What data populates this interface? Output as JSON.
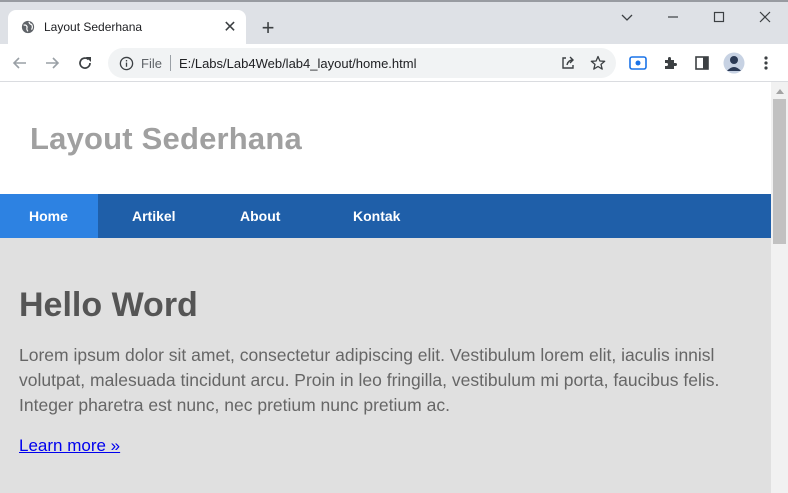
{
  "browser": {
    "tab": {
      "title": "Layout Sederhana",
      "favicon": "globe-icon"
    },
    "new_tab_symbol": "+",
    "close_symbol": "✕",
    "address": {
      "scheme": "File",
      "url": "E:/Labs/Lab4Web/lab4_layout/home.html"
    },
    "icons": [
      "back-icon",
      "forward-icon",
      "reload-icon",
      "info-icon",
      "share-icon",
      "star-icon",
      "screencast-icon",
      "extensions-icon",
      "side-panel-icon",
      "avatar",
      "menu-icon"
    ]
  },
  "page": {
    "site_title": "Layout Sederhana",
    "nav": [
      {
        "label": "Home",
        "active": true
      },
      {
        "label": "Artikel",
        "active": false
      },
      {
        "label": "About",
        "active": false
      },
      {
        "label": "Kontak",
        "active": false
      }
    ],
    "hero": {
      "heading": "Hello Word",
      "body": "Lorem ipsum dolor sit amet, consectetur adipiscing elit. Vestibulum lorem elit, iaculis innisl volutpat, malesuada tincidunt arcu. Proin in leo fringilla, vestibulum mi porta, faucibus felis. Integer pharetra est nunc, nec pretium nunc pretium ac.",
      "link": "Learn more »"
    }
  },
  "colors": {
    "nav_bg": "#1f5fa9",
    "nav_active": "#2d82e2",
    "hero_bg": "#e0e0e0",
    "site_title": "#a0a0a0",
    "link": "#0000ee"
  }
}
